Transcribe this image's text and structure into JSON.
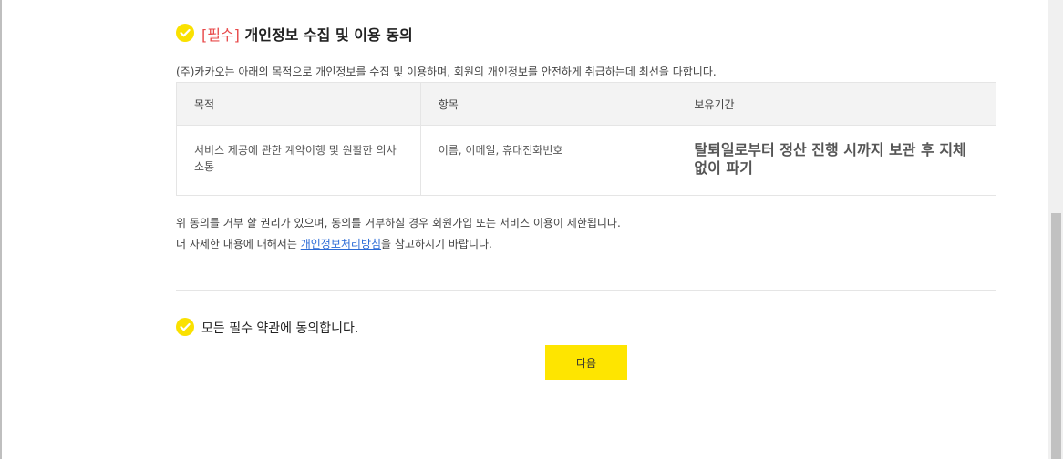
{
  "consent": {
    "required_tag": "[필수]",
    "title": "개인정보 수집 및 이용 동의",
    "intro": "(주)카카오는 아래의 목적으로 개인정보를 수집 및 이용하며, 회원의 개인정보를 안전하게 취급하는데 최선을 다합니다.",
    "table": {
      "headers": [
        "목적",
        "항목",
        "보유기간"
      ],
      "row": {
        "purpose": "서비스 제공에 관한 계약이행 및 원활한 의사소통",
        "items": "이름, 이메일, 휴대전화번호",
        "retention": "탈퇴일로부터 정산 진행 시까지 보관 후 지체없이 파기"
      }
    },
    "note_line1": "위 동의를 거부 할 권리가 있으며, 동의를 거부하실 경우 회원가입 또는 서비스 이용이 제한됩니다.",
    "note_line2_prefix": "더 자세한 내용에 대해서는 ",
    "policy_link": "개인정보처리방침",
    "note_line2_suffix": "을 참고하시기 바랍니다."
  },
  "agree_all": {
    "label": "모든 필수 약관에 동의합니다."
  },
  "next_button": {
    "label": "다음"
  },
  "colors": {
    "accent": "#fae100",
    "required": "#e8494a",
    "link": "#2b6bd6"
  },
  "icons": {
    "check": "check-circle-icon"
  }
}
